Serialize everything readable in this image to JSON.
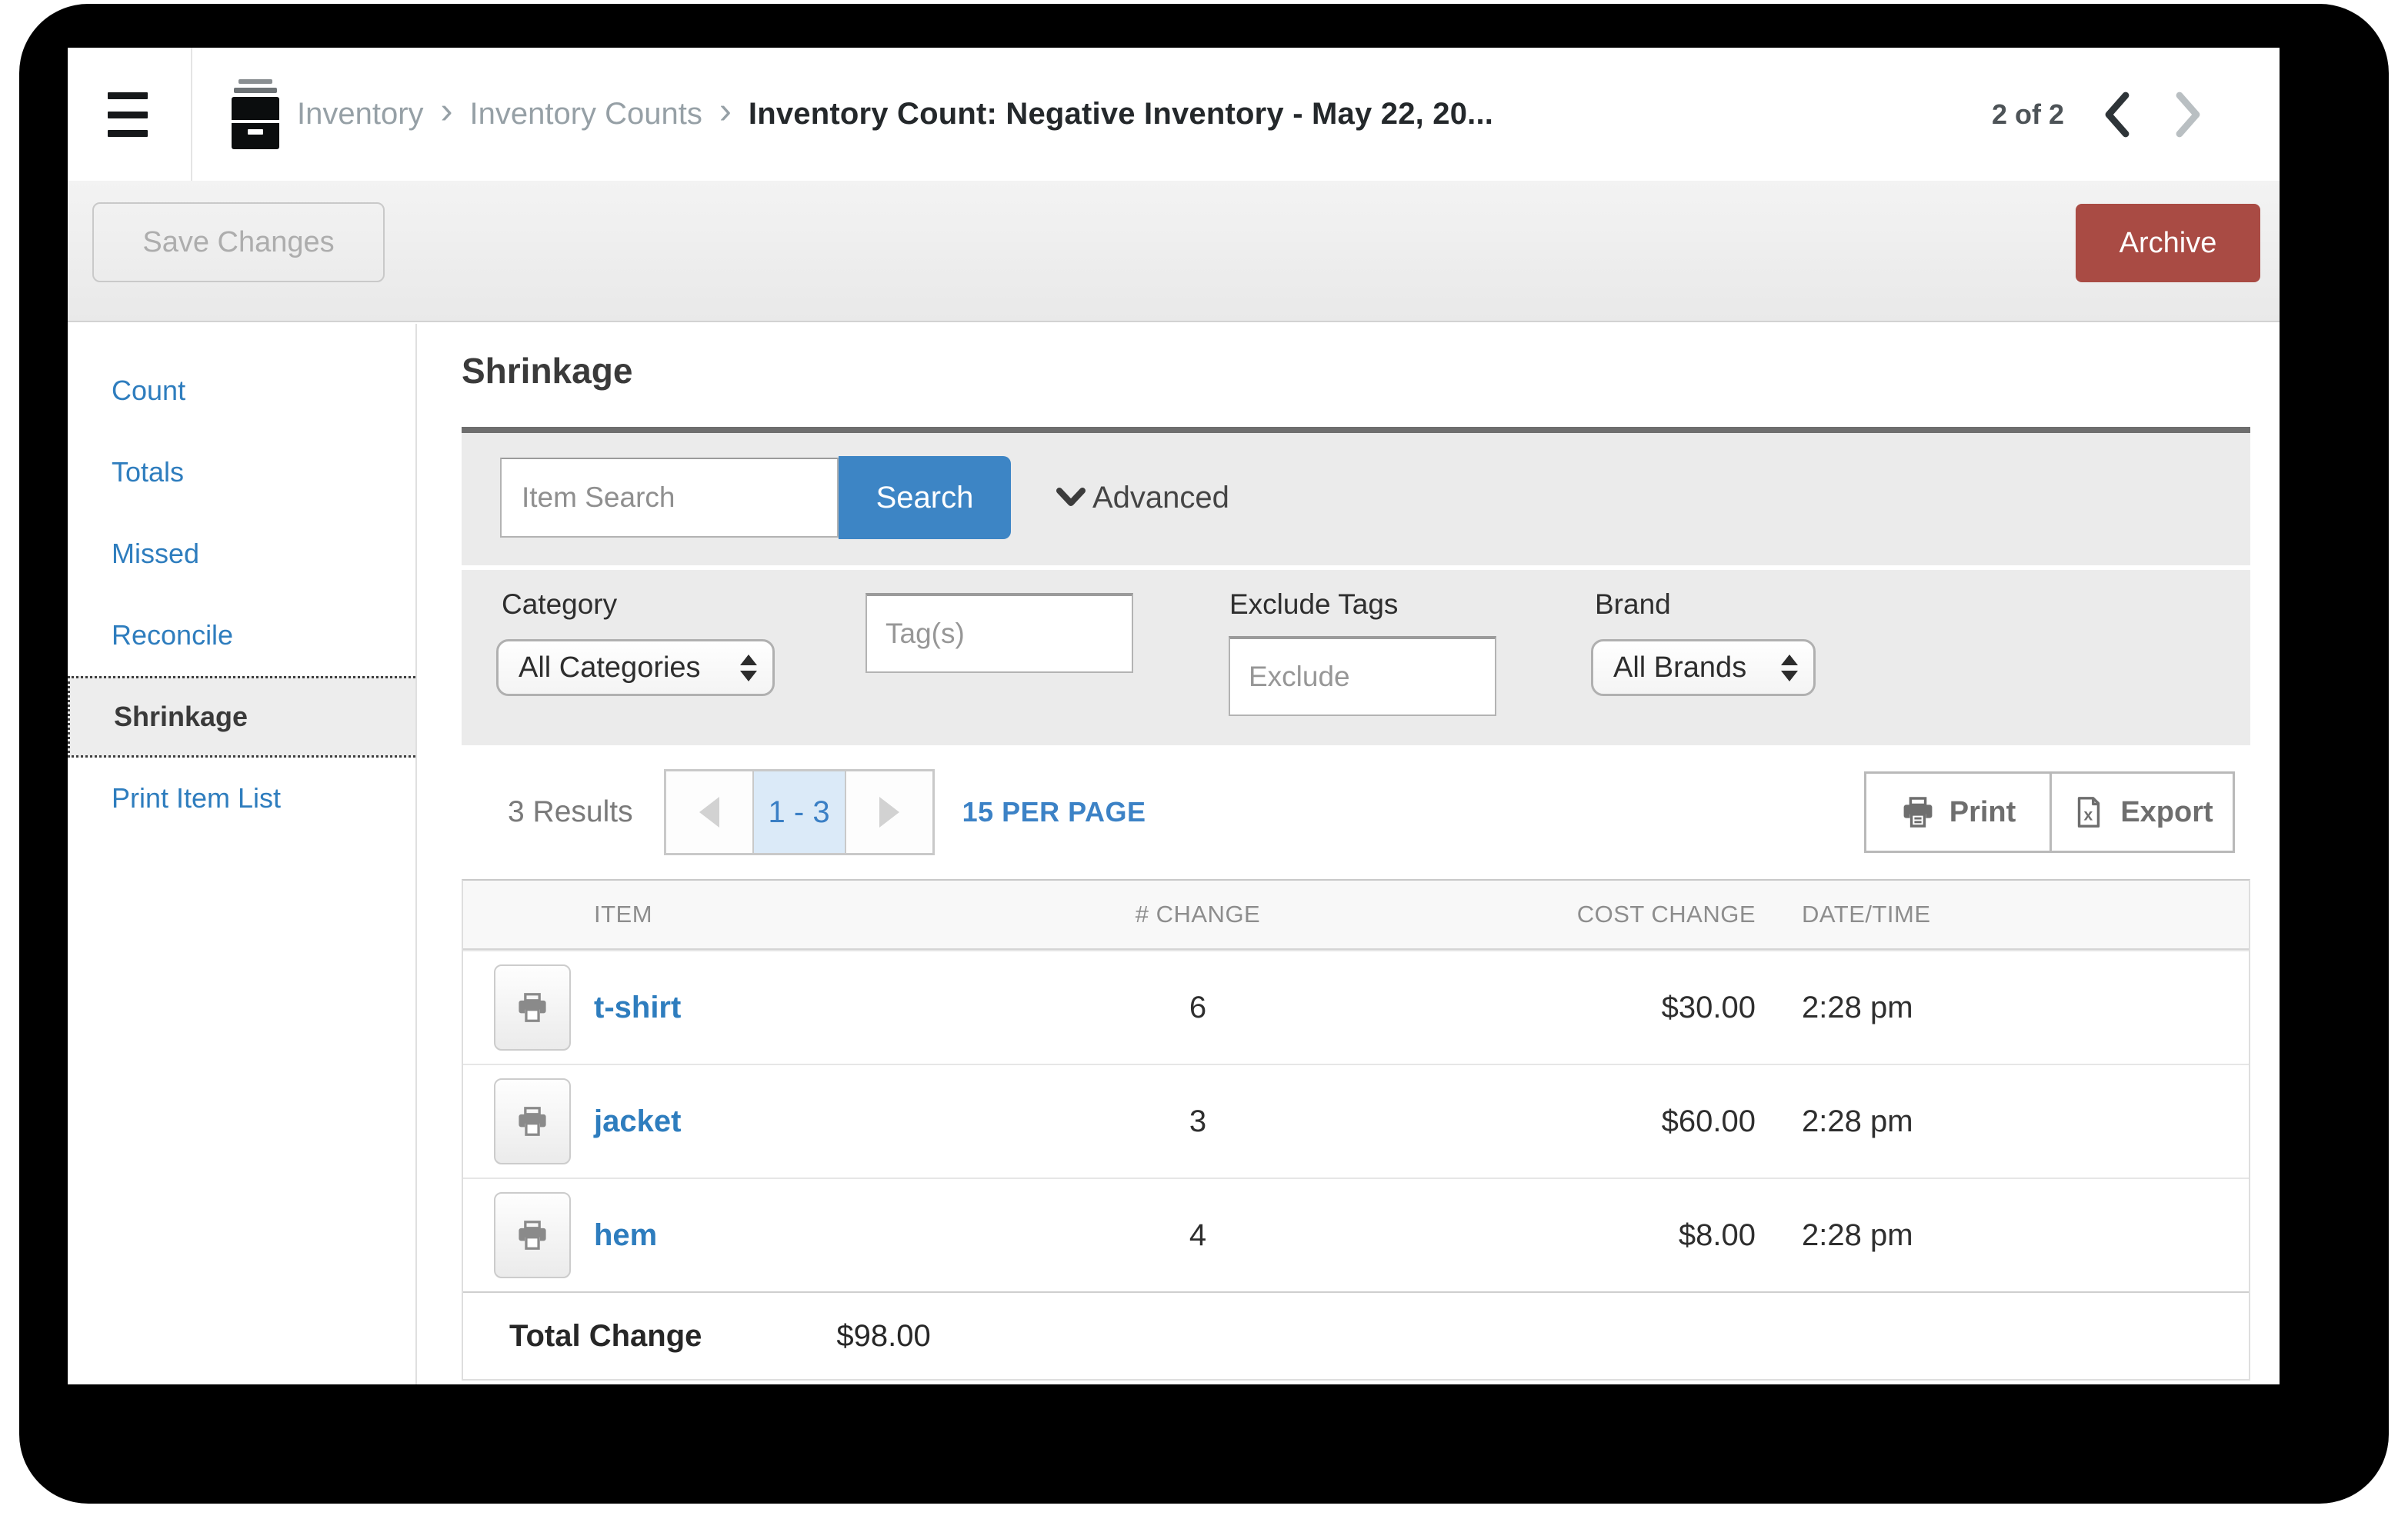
{
  "window": {
    "breadcrumb": {
      "items": [
        "Inventory",
        "Inventory Counts"
      ],
      "current": "Inventory Count: Negative Inventory - May 22, 20...",
      "pager": "2 of 2"
    },
    "toolbar": {
      "save_label": "Save Changes",
      "archive_label": "Archive"
    },
    "sidebar": {
      "items": [
        "Count",
        "Totals",
        "Missed",
        "Reconcile",
        "Shrinkage",
        "Print Item List"
      ],
      "selected": "Shrinkage"
    },
    "main": {
      "title": "Shrinkage",
      "search": {
        "placeholder": "Item Search",
        "button": "Search",
        "advanced": "Advanced"
      },
      "filters": {
        "category": {
          "label": "Category",
          "value": "All Categories"
        },
        "tags": {
          "placeholder": "Tag(s)"
        },
        "exclude_tags": {
          "label": "Exclude Tags",
          "placeholder": "Exclude"
        },
        "brand": {
          "label": "Brand",
          "value": "All Brands"
        }
      },
      "results": {
        "count": "3 Results",
        "page_range": "1 - 3",
        "per_page": "15 PER PAGE",
        "print": "Print",
        "export": "Export"
      },
      "table": {
        "headers": [
          "ITEM",
          "# CHANGE",
          "COST CHANGE",
          "DATE/TIME"
        ],
        "rows": [
          {
            "item": "t-shirt",
            "change": "6",
            "cost_change": "$30.00",
            "datetime": "2:28 pm"
          },
          {
            "item": "jacket",
            "change": "3",
            "cost_change": "$60.00",
            "datetime": "2:28 pm"
          },
          {
            "item": "hem",
            "change": "4",
            "cost_change": "$8.00",
            "datetime": "2:28 pm"
          }
        ],
        "total_label": "Total Change",
        "total_value": "$98.00"
      }
    },
    "icons": {
      "breadcrumb_separator": "›"
    },
    "colors": {
      "accent_blue": "#3D85C5",
      "link_blue": "#2E7DBE",
      "archive_red": "#A94B44",
      "pagination_active_bg": "#DBEAF8",
      "panel_gray": "#EBEBEB"
    }
  }
}
